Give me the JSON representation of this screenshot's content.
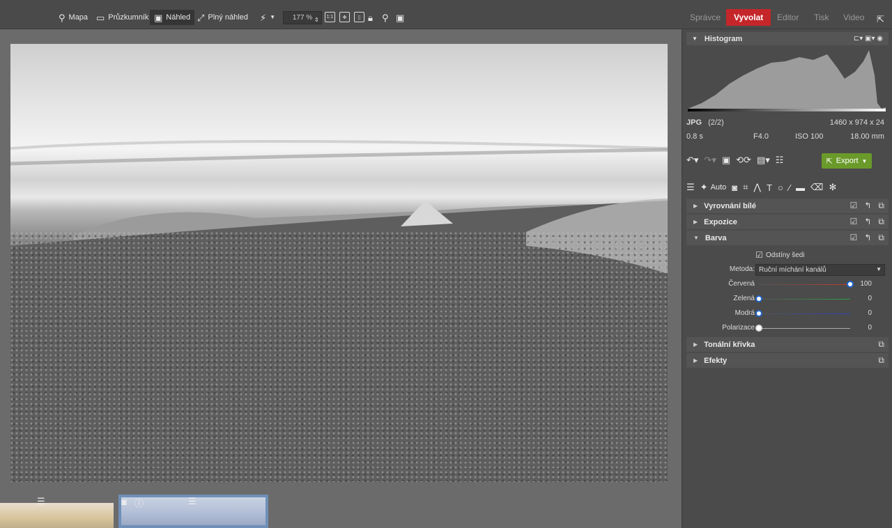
{
  "toolbar": {
    "map": "Mapa",
    "browser": "Průzkumník",
    "preview": "Náhled",
    "fullview": "Plný náhled",
    "zoom": "177 %",
    "one_to_one": "1:1"
  },
  "modes": [
    "Správce",
    "Vyvolat",
    "Editor",
    "Tisk",
    "Video"
  ],
  "active_mode": "Vyvolat",
  "histogram": {
    "title": "Histogram",
    "format": "JPG",
    "index": "(2/2)",
    "dimensions": "1460 x 974 x 24",
    "shutter": "0.8 s",
    "aperture": "F4.0",
    "iso": "ISO 100",
    "focal": "18.00 mm"
  },
  "actions": {
    "export": "Export",
    "auto": "Auto"
  },
  "sections": {
    "white_balance": "Vyrovnání bílé",
    "exposure": "Expozice",
    "color": "Barva",
    "tone_curve": "Tonální křivka",
    "effects": "Efekty"
  },
  "color_panel": {
    "grayscale_label": "Odstíny šedi",
    "grayscale_checked": true,
    "method_label": "Metoda:",
    "method_value": "Ruční míchání kanálů",
    "sliders": [
      {
        "label": "Červená",
        "value": "100",
        "color": "#c0392b"
      },
      {
        "label": "Zelená",
        "value": "0",
        "color": "#2ea043"
      },
      {
        "label": "Modrá",
        "value": "0",
        "color": "#2a3fbf"
      },
      {
        "label": "Polarizace",
        "value": "0",
        "color": "#bbbbbb"
      }
    ]
  },
  "colors": {
    "accent": "#c5262a",
    "export": "#6a9a2a",
    "panel": "#4b4b4b"
  }
}
